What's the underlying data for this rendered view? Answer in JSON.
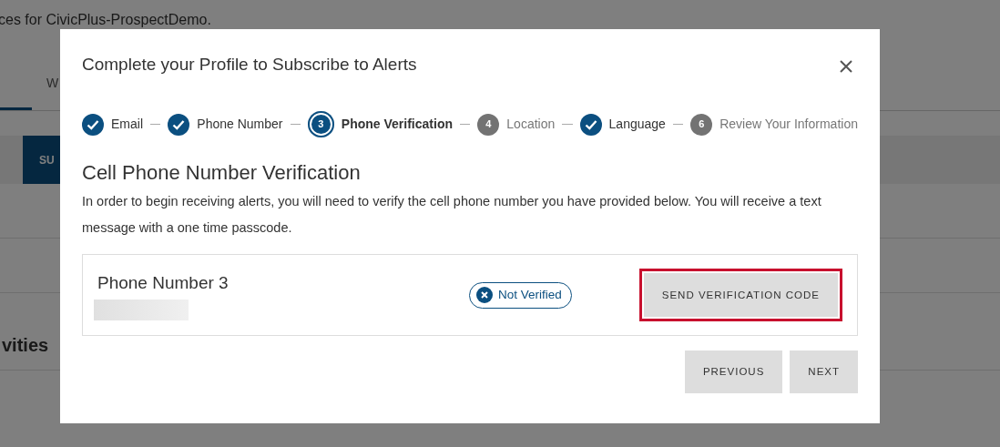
{
  "background": {
    "intro": "ces for CivicPlus-ProspectDemo.",
    "tab": "W",
    "button": "SU",
    "heading": "vities"
  },
  "modal": {
    "title": "Complete your Profile to Subscribe to Alerts",
    "steps": [
      {
        "label": "Email",
        "completed": true,
        "current": false
      },
      {
        "label": "Phone Number",
        "completed": true,
        "current": false
      },
      {
        "label": "Phone Verification",
        "completed": false,
        "current": true,
        "number": "3"
      },
      {
        "label": "Location",
        "completed": false,
        "current": false,
        "number": "4"
      },
      {
        "label": "Language",
        "completed": true,
        "current": false
      },
      {
        "label": "Review Your Information",
        "completed": false,
        "current": false,
        "number": "6"
      }
    ],
    "heading": "Cell Phone Number Verification",
    "description": "In order to begin receiving alerts, you will need to verify the cell phone number you have provided below. You will receive a text message with a one time passcode.",
    "phone": {
      "label": "Phone Number 3",
      "verified": false,
      "status": "Not Verified",
      "action": "SEND VERIFICATION CODE",
      "highlighted": true
    },
    "buttons": [
      "PREVIOUS",
      "NEXT"
    ]
  }
}
